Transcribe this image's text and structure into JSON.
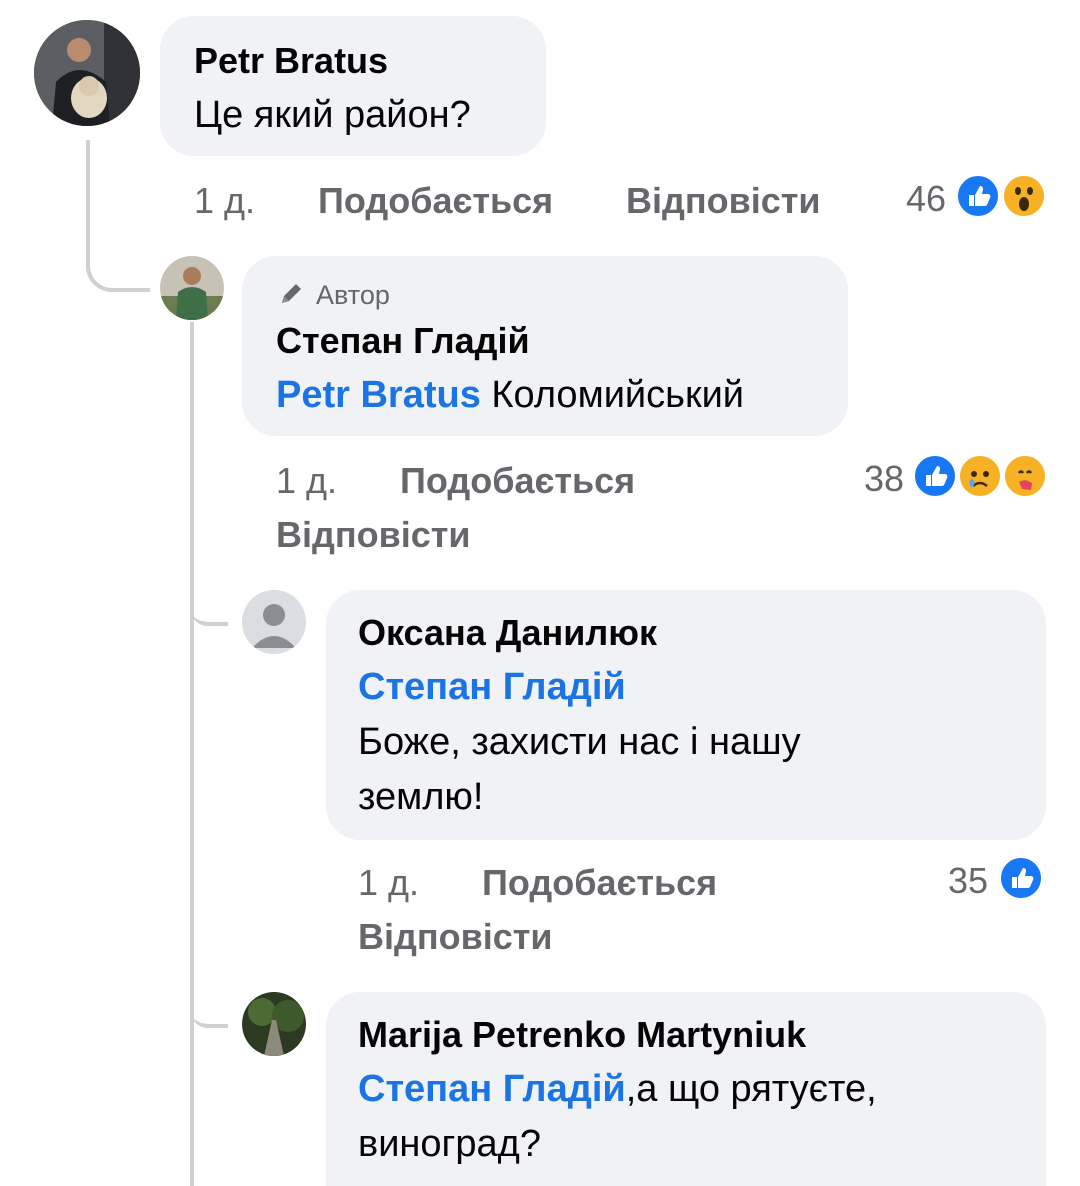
{
  "comments": [
    {
      "author": "Petr Bratus",
      "text": "Це який район?",
      "time": "1 д.",
      "like": "Подобається",
      "reply": "Відповісти",
      "reaction_count": "46",
      "reactions": [
        "like",
        "wow"
      ]
    },
    {
      "badge": "Автор",
      "author": "Степан Гладій",
      "mention": "Petr Bratus",
      "text": " Коломийський",
      "time": "1 д.",
      "like": "Подобається",
      "reply": "Відповісти",
      "reaction_count": "38",
      "reactions": [
        "like",
        "sad",
        "care"
      ]
    },
    {
      "author": "Оксана Данилюк",
      "mention": "Степан Гладій",
      "text_line1": "Боже, захисти нас і нашу",
      "text_line2": "землю!",
      "time": "1 д.",
      "like": "Подобається",
      "reply": "Відповісти",
      "reaction_count": "35",
      "reactions": [
        "like"
      ]
    },
    {
      "author": "Marija Petrenko Martyniuk",
      "mention": "Степан Гладій",
      "text_line1": ",а що рятуєте,",
      "text_line2": "виноград?"
    }
  ],
  "colors": {
    "bubble": "#f0f2f5",
    "link": "#1b74e4",
    "meta": "#65676b",
    "like": "#1877f2"
  }
}
